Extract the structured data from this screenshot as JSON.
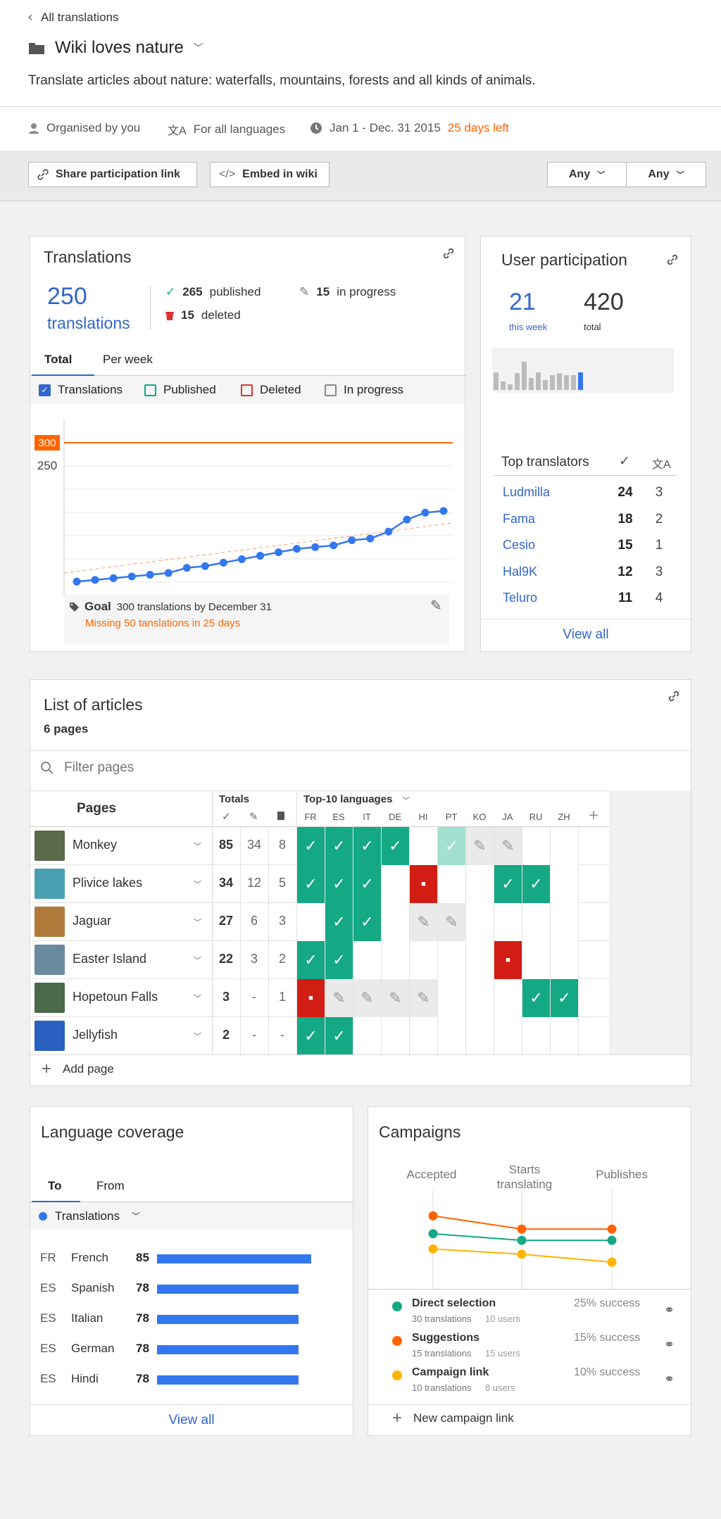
{
  "header": {
    "back_label": "All translations",
    "title": "Wiki loves nature",
    "description": "Translate articles about nature: waterfalls, mountains, forests and all kinds of animals."
  },
  "meta": {
    "organiser": "Organised by you",
    "languages": "For all languages",
    "dates": "Jan 1 - Dec. 31 2015",
    "days_left": "25 days left"
  },
  "toolbar": {
    "share_label": "Share participation link",
    "embed_label": "Embed in wiki",
    "filter1": "Any",
    "filter2": "Any"
  },
  "translations": {
    "title": "Translations",
    "count": "250",
    "count_label": "translations",
    "published": "265",
    "published_label": "published",
    "deleted": "15",
    "deleted_label": "deleted",
    "in_progress": "15",
    "in_progress_label": "in progress",
    "tabs": [
      "Total",
      "Per week"
    ],
    "legend": [
      "Translations",
      "Published",
      "Deleted",
      "In progress"
    ],
    "goal_label": "Goal",
    "goal_text": "300 translations by December 31",
    "goal_missing": "Missing 50 tanslations in 25 days"
  },
  "chart_data": {
    "type": "line",
    "series": [
      {
        "values": [
          6,
          7,
          8,
          9,
          10,
          11,
          14,
          15,
          17,
          19,
          21,
          23,
          25,
          26,
          27,
          30,
          31,
          35,
          42,
          46,
          47
        ]
      }
    ],
    "ylim": [
      0,
      100
    ],
    "goal_value_label": "300",
    "tick_label": "250",
    "goal_color": "#ff6400",
    "line_color": "#3377ee"
  },
  "participation": {
    "title": "User participation",
    "week_count": "21",
    "week_label": "this week",
    "total_count": "420",
    "total_label": "total",
    "bars": [
      0.45,
      0.22,
      0.15,
      0.42,
      0.72,
      0.3,
      0.45,
      0.25,
      0.38,
      0.42,
      0.38,
      0.38,
      0.45
    ],
    "top_title": "Top translators",
    "translators": [
      {
        "name": "Ludmilla",
        "pub": "24",
        "prog": "3"
      },
      {
        "name": "Fama",
        "pub": "18",
        "prog": "2"
      },
      {
        "name": "Cesio",
        "pub": "15",
        "prog": "1"
      },
      {
        "name": "Hal9K",
        "pub": "12",
        "prog": "3"
      },
      {
        "name": "Teluro",
        "pub": "11",
        "prog": "4"
      }
    ],
    "view_all": "View all"
  },
  "articles": {
    "title": "List of articles",
    "subtitle": "6 pages",
    "filter_placeholder": "Filter pages",
    "col_pages": "Pages",
    "col_totals": "Totals",
    "col_top": "Top-10 languages",
    "langs": [
      "FR",
      "ES",
      "IT",
      "DE",
      "HI",
      "PT",
      "KO",
      "JA",
      "RU",
      "ZH"
    ],
    "rows": [
      {
        "name": "Monkey",
        "pub": "85",
        "prog": "34",
        "del": "8",
        "cells": [
          "p",
          "p",
          "p",
          "p",
          "",
          "l",
          "g",
          "g",
          "",
          ""
        ],
        "thumb": "#5a6a4a"
      },
      {
        "name": "Plivice lakes",
        "pub": "34",
        "prog": "12",
        "del": "5",
        "cells": [
          "p",
          "p",
          "p",
          "",
          "d",
          "",
          "",
          "p",
          "p",
          ""
        ],
        "thumb": "#4aa0b0"
      },
      {
        "name": "Jaguar",
        "pub": "27",
        "prog": "6",
        "del": "3",
        "cells": [
          "",
          "p",
          "p",
          "",
          "g",
          "g",
          "",
          "",
          "",
          ""
        ],
        "thumb": "#b07a3a"
      },
      {
        "name": "Easter Island",
        "pub": "22",
        "prog": "3",
        "del": "2",
        "cells": [
          "p",
          "p",
          "",
          "",
          "",
          "",
          "",
          "d",
          "",
          ""
        ],
        "thumb": "#6a8aa0"
      },
      {
        "name": "Hopetoun Falls",
        "pub": "3",
        "prog": "-",
        "del": "1",
        "cells": [
          "d",
          "g",
          "g",
          "g",
          "g",
          "",
          "",
          "",
          "p",
          "p"
        ],
        "thumb": "#4a6a4a"
      },
      {
        "name": "Jellyfish",
        "pub": "2",
        "prog": "-",
        "del": "-",
        "cells": [
          "p",
          "p",
          "",
          "",
          "",
          "",
          "",
          "",
          "",
          ""
        ],
        "thumb": "#2a60c0"
      }
    ],
    "add_page": "Add page"
  },
  "coverage": {
    "title": "Language coverage",
    "tabs": [
      "To",
      "From"
    ],
    "filter": "Translations",
    "rows": [
      {
        "code": "FR",
        "name": "French",
        "value": 85
      },
      {
        "code": "ES",
        "name": "Spanish",
        "value": 78
      },
      {
        "code": "ES",
        "name": "Italian",
        "value": 78
      },
      {
        "code": "ES",
        "name": "German",
        "value": 78
      },
      {
        "code": "ES",
        "name": "Hindi",
        "value": 78
      }
    ],
    "view_all": "View all"
  },
  "campaigns": {
    "title": "Campaigns",
    "stages": [
      "Accepted",
      "Starts translating",
      "Publishes"
    ],
    "items": [
      {
        "name": "Direct selection",
        "translations": "30 translations",
        "users": "10 users",
        "success": "25% success",
        "color": "#14a884",
        "values": [
          0.55,
          0.65,
          0.65
        ]
      },
      {
        "name": "Suggestions",
        "translations": "15 translations",
        "users": "15 users",
        "success": "15% success",
        "color": "#ff6400",
        "values": [
          0.28,
          0.48,
          0.48
        ]
      },
      {
        "name": "Campaign link",
        "translations": "10 translations",
        "users": "8 users",
        "success": "10% success",
        "color": "#ffb400",
        "values": [
          0.78,
          0.86,
          0.98
        ]
      }
    ],
    "new_label": "New campaign link"
  }
}
